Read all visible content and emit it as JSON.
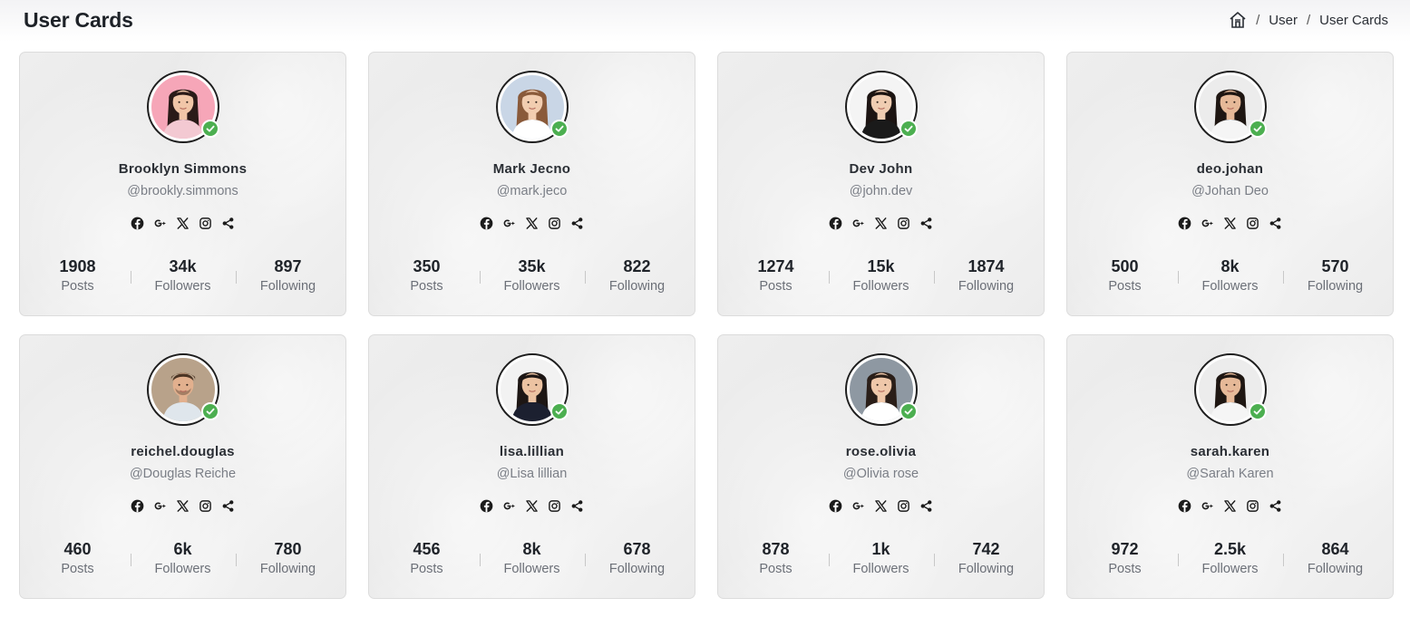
{
  "header": {
    "title": "User Cards",
    "breadcrumb": [
      "User",
      "User Cards"
    ]
  },
  "colors": {
    "online": "#4caf50"
  },
  "stat_labels": {
    "posts": "Posts",
    "followers": "Followers",
    "following": "Following"
  },
  "social_icons": [
    "facebook-icon",
    "google-plus-icon",
    "x-icon",
    "instagram-icon",
    "share-icon"
  ],
  "cards": [
    {
      "name": "Brooklyn Simmons",
      "handle": "@brookly.simmons",
      "posts": "1908",
      "followers": "34k",
      "following": "897"
    },
    {
      "name": "Mark Jecno",
      "handle": "@mark.jeco",
      "posts": "350",
      "followers": "35k",
      "following": "822"
    },
    {
      "name": "Dev John",
      "handle": "@john.dev",
      "posts": "1274",
      "followers": "15k",
      "following": "1874"
    },
    {
      "name": "deo.johan",
      "handle": "@Johan Deo",
      "posts": "500",
      "followers": "8k",
      "following": "570"
    },
    {
      "name": "reichel.douglas",
      "handle": "@Douglas Reiche",
      "posts": "460",
      "followers": "6k",
      "following": "780"
    },
    {
      "name": "lisa.lillian",
      "handle": "@Lisa lillian",
      "posts": "456",
      "followers": "8k",
      "following": "678"
    },
    {
      "name": "rose.olivia",
      "handle": "@Olivia rose",
      "posts": "878",
      "followers": "1k",
      "following": "742"
    },
    {
      "name": "sarah.karen",
      "handle": "@Sarah Karen",
      "posts": "972",
      "followers": "2.5k",
      "following": "864"
    }
  ]
}
